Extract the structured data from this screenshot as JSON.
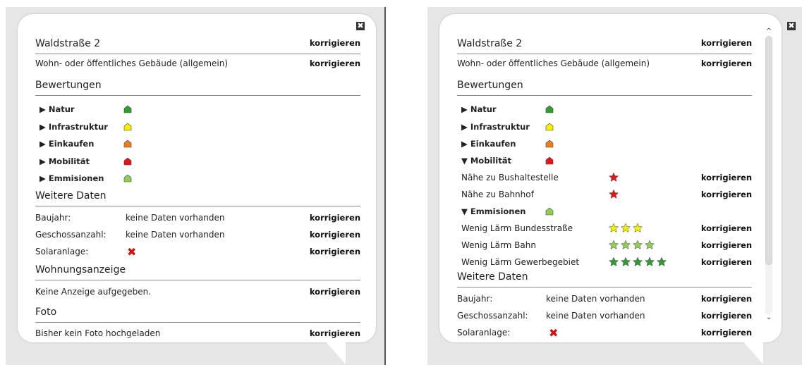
{
  "common": {
    "action": "korrigieren",
    "close": "✖"
  },
  "left": {
    "address": "Waldstraße 2",
    "building": "Wohn- oder öffentliches Gebäude (allgemein)",
    "ratings_title": "Bewertungen",
    "categories": [
      {
        "label": "▶ Natur",
        "color": "#2e9e2e"
      },
      {
        "label": "▶ Infrastruktur",
        "color": "#f5f000"
      },
      {
        "label": "▶ Einkaufen",
        "color": "#ef7d1b"
      },
      {
        "label": "▶ Mobilität",
        "color": "#e3161b"
      },
      {
        "label": "▶ Emmisionen",
        "color": "#8fd14f"
      }
    ],
    "more_title": "Weitere Daten",
    "more": [
      {
        "label": "Baujahr:",
        "value": "keine Daten vorhanden"
      },
      {
        "label": "Geschossanzahl:",
        "value": "keine Daten vorhanden"
      },
      {
        "label": "Solaranlage:",
        "value": "✖"
      }
    ],
    "ad_title": "Wohnungsanzeige",
    "ad_text": "Keine Anzeige aufgegeben.",
    "photo_title": "Foto",
    "photo_text": "Bisher kein Foto hochgeladen"
  },
  "right": {
    "address": "Waldstraße 2",
    "building": "Wohn- oder öffentliches Gebäude (allgemein)",
    "ratings_title": "Bewertungen",
    "categories_top": [
      {
        "label": "▶ Natur",
        "color": "#2e9e2e"
      },
      {
        "label": "▶ Infrastruktur",
        "color": "#f5f000"
      },
      {
        "label": "▶ Einkaufen",
        "color": "#ef7d1b"
      }
    ],
    "mobility": {
      "label": "▼ Mobilität",
      "color": "#e3161b"
    },
    "mobility_items": [
      {
        "label": "Nähe zu Bushaltestelle",
        "stars": 1,
        "star_color": "#e3161b"
      },
      {
        "label": "Nähe zu Bahnhof",
        "stars": 1,
        "star_color": "#e3161b"
      }
    ],
    "emissions": {
      "label": "▼ Emmisionen",
      "color": "#8fd14f"
    },
    "emission_items": [
      {
        "label": "Wenig Lärm Bundesstraße",
        "stars": 3,
        "star_color": "#f5f000"
      },
      {
        "label": "Wenig Lärm Bahn",
        "stars": 4,
        "star_color": "#8fd14f"
      },
      {
        "label": "Wenig Lärm Gewerbegebiet",
        "stars": 5,
        "star_color": "#2e9e2e"
      }
    ],
    "more_title": "Weitere Daten",
    "more": [
      {
        "label": "Baujahr:",
        "value": "keine Daten vorhanden"
      },
      {
        "label": "Geschossanzahl:",
        "value": "keine Daten vorhanden"
      },
      {
        "label": "Solaranlage:",
        "value": "✖"
      }
    ],
    "scrollbar": {
      "up": "^",
      "down": "⌄"
    }
  }
}
